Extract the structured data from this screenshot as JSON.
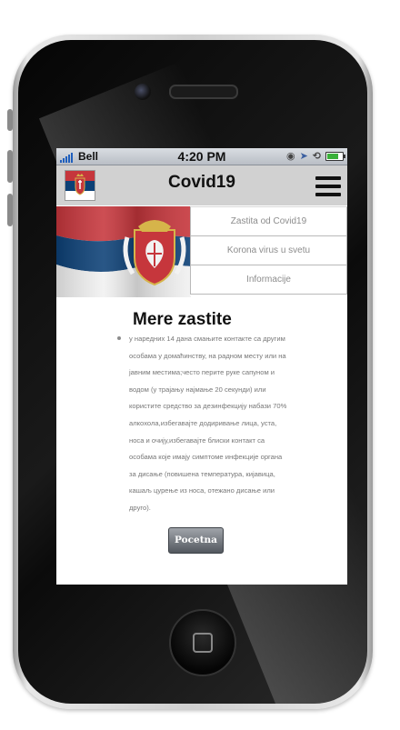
{
  "status_bar": {
    "carrier": "Bell",
    "time": "4:20 PM"
  },
  "header": {
    "title": "Covid19",
    "menu_icon": "hamburger-menu-icon",
    "flag_icon": "serbia-flag-icon"
  },
  "menu": {
    "items": [
      {
        "label": "Zastita od Covid19"
      },
      {
        "label": "Korona virus u svetu"
      },
      {
        "label": "Informacije"
      }
    ]
  },
  "content": {
    "title": "Mere zastite",
    "lines": [
      "у наредних 14 дана смањите контакте са другим",
      "особама у домаћинству, на радном месту или на",
      "јавним местима;често перите руке сапуном и",
      "водом (у трајању најмање 20 секунди) или",
      "користите средство за дезинфекцију набази 70%",
      "алкохола,избегавајте додиривање лица, уста,",
      "носа и очију,избегавајте блиски контакт са",
      "особама које имају симптоме инфекције органа",
      "за дисање (повишена температура, кијавица,",
      "кашаљ цурење из носа, отежано дисање или",
      "друго)."
    ]
  },
  "buttons": {
    "home_label": "Pocetna"
  },
  "colors": {
    "navbar": "#d1d1d1",
    "serbia_red": "#c6363c",
    "serbia_blue": "#0c4076",
    "serbia_white": "#ffffff"
  }
}
